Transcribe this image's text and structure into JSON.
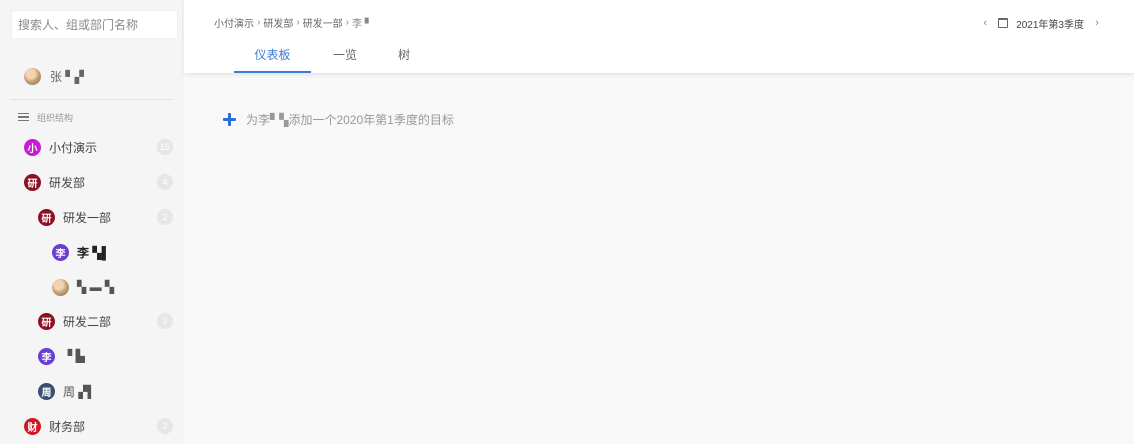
{
  "search": {
    "placeholder": "搜索人、组或部门名称"
  },
  "current_user": {
    "name": "张 ▘▞"
  },
  "org_section": {
    "label": "组织结构"
  },
  "org_tree": [
    {
      "avatar_text": "小",
      "avatar_color": "#c51bd4",
      "name": "小付演示",
      "count": "15",
      "level": 0
    },
    {
      "avatar_text": "研",
      "avatar_color": "#8b1022",
      "name": "研发部",
      "count": "4",
      "level": 0
    },
    {
      "avatar_text": "研",
      "avatar_color": "#8b1022",
      "name": "研发一部",
      "count": "2",
      "level": 1
    },
    {
      "avatar_text": "李",
      "avatar_color": "#6a3ed3",
      "name": "李 ▚▌",
      "count": "",
      "level": 2,
      "selected": true
    },
    {
      "avatar_text": "",
      "avatar_color": "",
      "name": "▚ ▬ ▚",
      "count": "",
      "level": 2,
      "photo": true
    },
    {
      "avatar_text": "研",
      "avatar_color": "#8b1022",
      "name": "研发二部",
      "count": "3",
      "level": 1
    },
    {
      "avatar_text": "李",
      "avatar_color": "#6a3ed3",
      "name": "▝ ▙",
      "count": "",
      "level": 1
    },
    {
      "avatar_text": "周",
      "avatar_color": "#3b4f6b",
      "name": "周 ▞▍",
      "count": "",
      "level": 1
    },
    {
      "avatar_text": "财",
      "avatar_color": "#d01a23",
      "name": "财务部",
      "count": "2",
      "level": 0
    }
  ],
  "breadcrumb": [
    {
      "label": "小付演示"
    },
    {
      "label": "研发部"
    },
    {
      "label": "研发一部"
    },
    {
      "label": "李 ▘"
    }
  ],
  "tabs": [
    {
      "label": "仪表板",
      "active": true
    },
    {
      "label": "一览",
      "active": false
    },
    {
      "label": "树",
      "active": false
    }
  ],
  "period": {
    "label": "2021年第3季度",
    "prev_icon": "chevron-left-icon",
    "next_icon": "chevron-right-icon",
    "calendar_icon": "calendar-icon"
  },
  "main": {
    "add_goal_text": "为李▘▚添加一个2020年第1季度的目标"
  },
  "colors": {
    "accent": "#3b7ad9",
    "plus": "#2a6fe0"
  }
}
